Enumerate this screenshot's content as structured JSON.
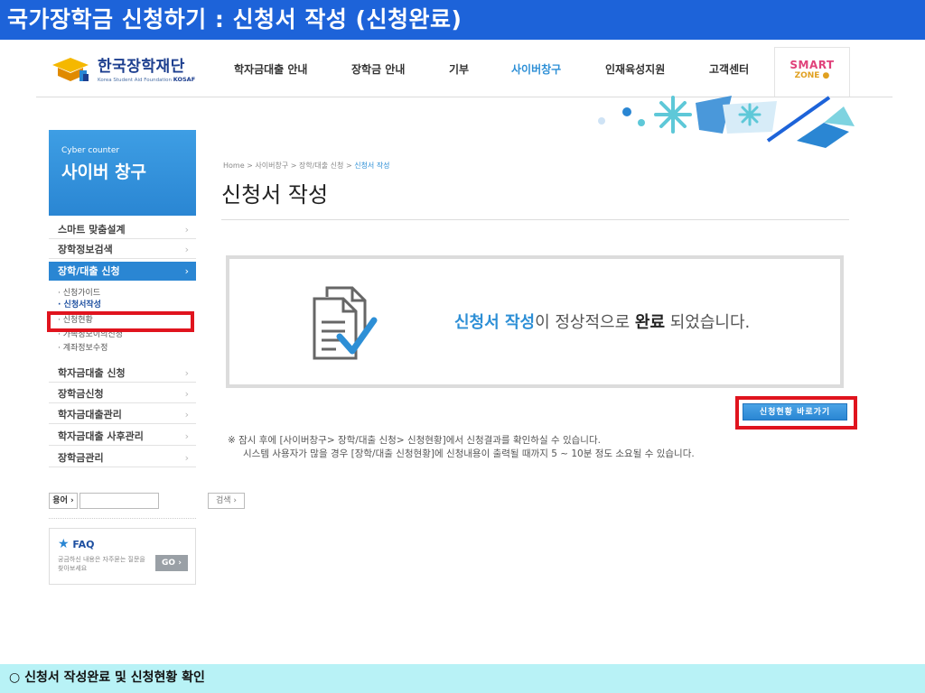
{
  "slide": {
    "title": "국가장학금 신청하기 : 신청서 작성 (신청완료)",
    "footer": "○ 신청서 작성완료 및 신청현황 확인"
  },
  "header": {
    "logo_name": "한국장학재단",
    "logo_sub": "Korea Student Aid Foundation",
    "logo_abbr": "KOSAF",
    "nav": [
      "학자금대출 안내",
      "장학금 안내",
      "기부",
      "사이버창구",
      "인재육성지원",
      "고객센터"
    ],
    "active_nav": "사이버창구",
    "smart_zone": {
      "line1": "SMART",
      "line2": "ZONE"
    }
  },
  "sidebar": {
    "banner_small": "Cyber counter",
    "banner_title": "사이버 창구",
    "menu_top": [
      "스마트 맞춤설계",
      "장학정보검색"
    ],
    "menu_active": "장학/대출 신청",
    "submenu": [
      "· 신청가이드",
      "· 신청서작성",
      "· 신청현황",
      "· 가족정보이의신청",
      "· 계좌정보수정"
    ],
    "menu_bottom": [
      "학자금대출 신청",
      "장학금신청",
      "학자금대출관리",
      "학자금대출 사후관리",
      "장학금관리"
    ],
    "arrow": "›",
    "glossary": {
      "label": "용어",
      "button": "검색 ›",
      "value": ""
    },
    "faq": {
      "title": "FAQ",
      "desc": "궁금하신 내용은 자주묻는 질문을 찾아보세요",
      "go": "GO ›"
    }
  },
  "main": {
    "breadcrumb": {
      "path": "Home > 사이버창구 > 장학/대출 신청 > ",
      "current": "신청서 작성"
    },
    "page_title": "신청서 작성",
    "message": {
      "part1": "신청서 작성",
      "part2": "이 정상적으로 ",
      "part3": "완료",
      "part4": " 되었습니다."
    },
    "status_button": "신청현황 바로가기",
    "notice_1": "※ 잠시 후에 [사이버창구> 장학/대출 신청> 신청현황]에서 신청결과를 확인하실 수 있습니다.",
    "notice_2": "시스템 사용자가 많을 경우 [장학/대출 신청현황]에 신청내용이 출력될 때까지 5 ~ 10분 정도 소요될 수 있습니다."
  },
  "colors": {
    "title_bar": "#1d63d9",
    "accent": "#2a86d3",
    "highlight": "#e0141e",
    "footer": "#b8f2f6"
  }
}
